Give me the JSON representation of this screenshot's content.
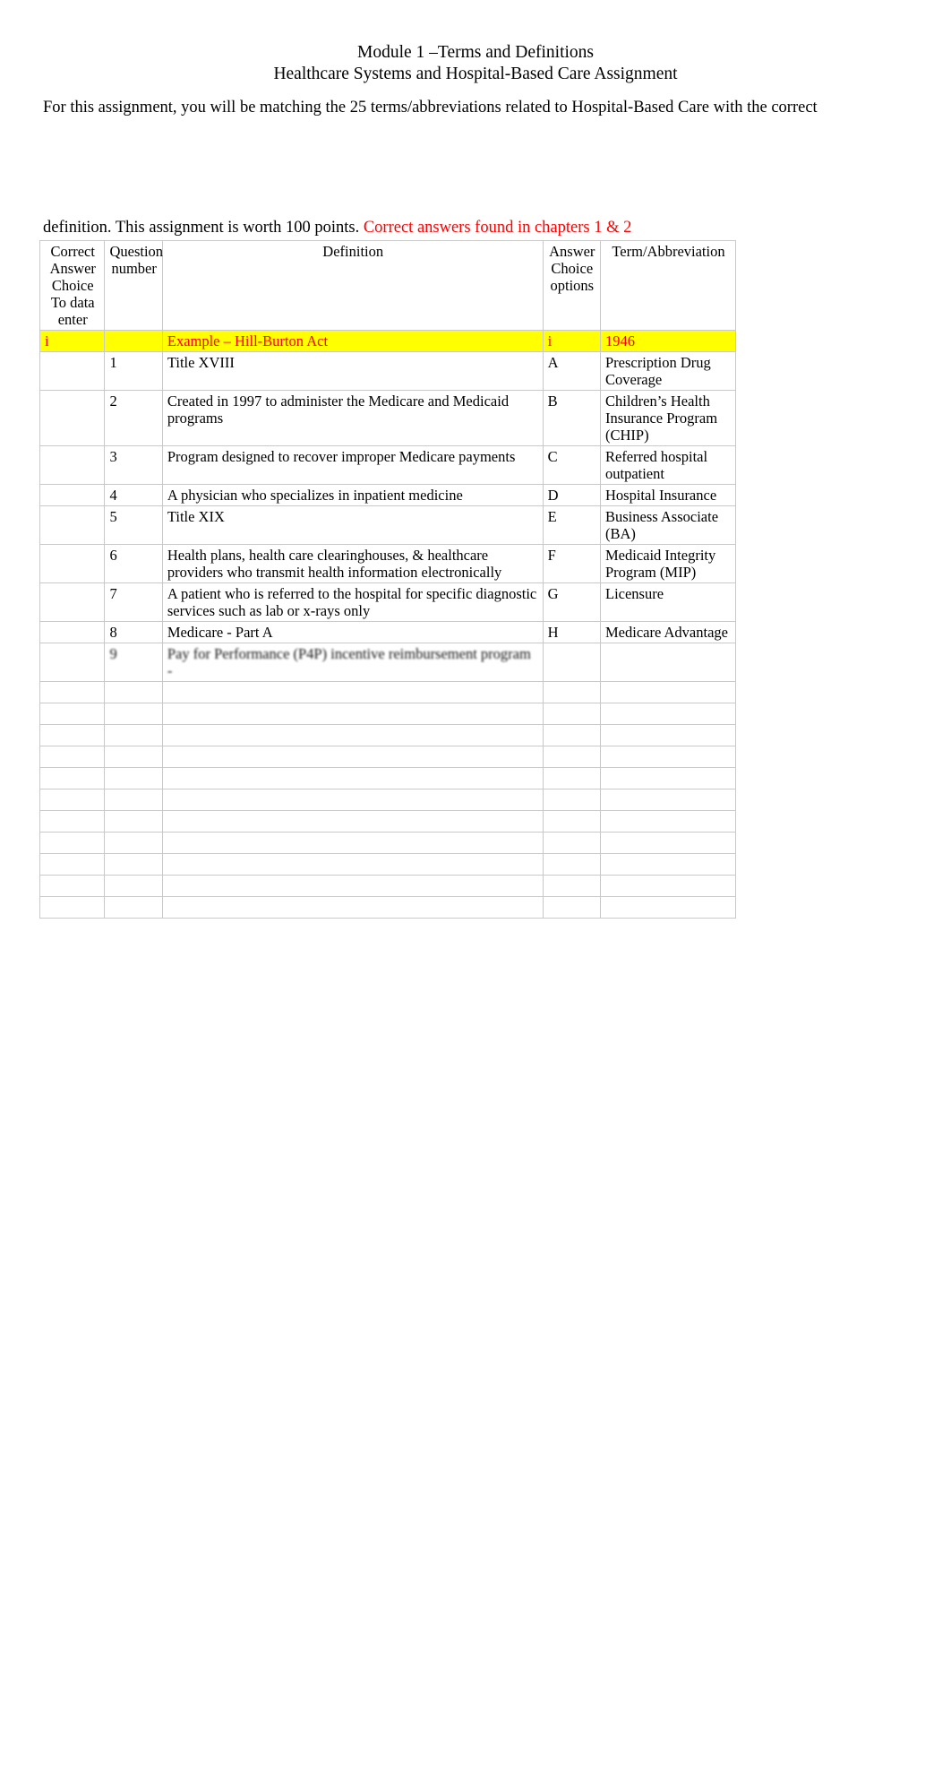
{
  "document": {
    "title_line_1": "Module 1 –Terms and Definitions",
    "title_line_2": "Healthcare Systems and Hospital-Based Care Assignment",
    "intro_paragraph_1": "For this assignment, you will be matching the 25 terms/abbreviations related to Hospital-Based Care with the correct",
    "intro_paragraph_2_plain": "definition.  This assignment is worth 100 points. ",
    "intro_paragraph_2_red": "Correct answers found in chapters 1 & 2",
    "highlight_color": "#ffff00",
    "accent_color": "#ff0000"
  },
  "table": {
    "headers": {
      "correct_answer_choice": [
        "Correct",
        "Answer",
        "Choice",
        "To data",
        "enter"
      ],
      "question_number": [
        "Question",
        "number"
      ],
      "definition": "Definition",
      "answer_choice_options": [
        "Answer",
        "Choice",
        "options"
      ],
      "term_abbreviation": "Term/Abbreviation"
    },
    "example_row": {
      "answer": "i",
      "number": "",
      "definition": "Example – Hill-Burton Act",
      "choice": "i",
      "term": "1946"
    },
    "rows": [
      {
        "answer": "",
        "number": "1",
        "definition": "Title XVIII",
        "choice": "A",
        "term": "Prescription Drug Coverage",
        "blur": 0
      },
      {
        "answer": "",
        "number": "2",
        "definition": "Created in 1997 to administer the Medicare and Medicaid programs",
        "choice": "B",
        "term": "Children’s Health Insurance Program (CHIP)",
        "blur": 0
      },
      {
        "answer": "",
        "number": "3",
        "definition": "Program designed to recover improper Medicare payments",
        "choice": "C",
        "term": "Referred hospital outpatient",
        "blur": 0
      },
      {
        "answer": "",
        "number": "4",
        "definition": "A physician who specializes in inpatient medicine",
        "choice": "D",
        "term": "Hospital Insurance",
        "blur": 0
      },
      {
        "answer": "",
        "number": "5",
        "definition": "Title XIX",
        "choice": "E",
        "term": "Business Associate (BA)",
        "blur": 0
      },
      {
        "answer": "",
        "number": "6",
        "definition": "Health plans, health care clearinghouses, & healthcare providers who transmit health information electronically",
        "choice": "F",
        "term": "Medicaid Integrity Program (MIP)",
        "blur": 0
      },
      {
        "answer": "",
        "number": "7",
        "definition": "A patient who is referred to the hospital for specific diagnostic services such as lab or x-rays only",
        "choice": "G",
        "term": "Licensure",
        "blur": 0
      },
      {
        "answer": "",
        "number": "8",
        "definition": "Medicare - Part A",
        "choice": "H",
        "term": "Medicare Advantage",
        "blur": 0
      },
      {
        "answer": "",
        "number": "9",
        "definition": "Pay for Performance (P4P) incentive reimbursement program -",
        "choice": "",
        "term": "",
        "blur": 1
      },
      {
        "answer": "",
        "number": "",
        "definition": "",
        "choice": "",
        "term": "",
        "blur": 2
      },
      {
        "answer": "",
        "number": "",
        "definition": "",
        "choice": "",
        "term": "",
        "blur": 3
      },
      {
        "answer": "",
        "number": "",
        "definition": "",
        "choice": "",
        "term": "",
        "blur": 3
      },
      {
        "answer": "",
        "number": "",
        "definition": "",
        "choice": "",
        "term": "",
        "blur": 4
      },
      {
        "answer": "",
        "number": "",
        "definition": "",
        "choice": "",
        "term": "",
        "blur": 4
      },
      {
        "answer": "",
        "number": "",
        "definition": "",
        "choice": "",
        "term": "",
        "blur": 4
      },
      {
        "answer": "",
        "number": "",
        "definition": "",
        "choice": "",
        "term": "",
        "blur": 5
      },
      {
        "answer": "",
        "number": "",
        "definition": "",
        "choice": "",
        "term": "",
        "blur": 5
      },
      {
        "answer": "",
        "number": "",
        "definition": "",
        "choice": "",
        "term": "",
        "blur": 5
      },
      {
        "answer": "",
        "number": "",
        "definition": "",
        "choice": "",
        "term": "",
        "blur": 5
      },
      {
        "answer": "",
        "number": "",
        "definition": "",
        "choice": "",
        "term": "",
        "blur": 5
      }
    ]
  }
}
